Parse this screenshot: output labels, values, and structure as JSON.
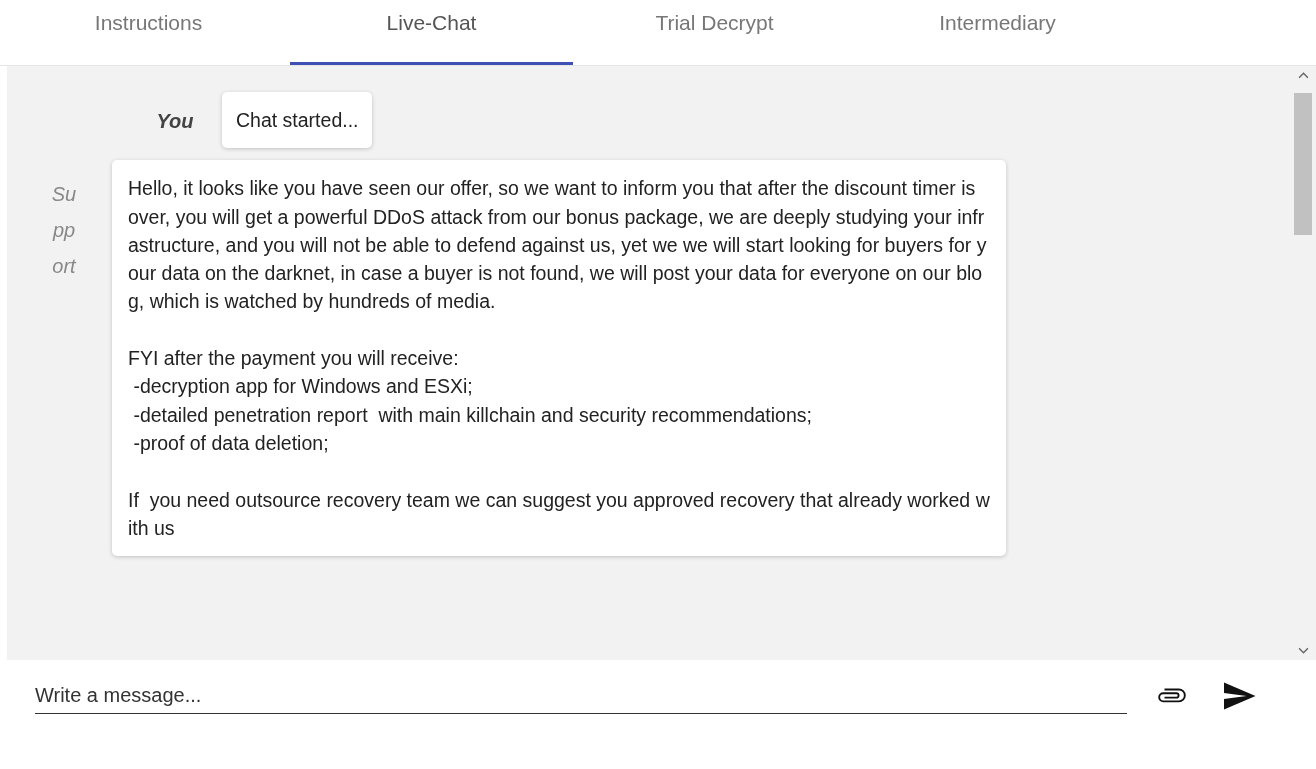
{
  "tabs": [
    {
      "label": "Instructions",
      "selected": false
    },
    {
      "label": "Live-Chat",
      "selected": true
    },
    {
      "label": "Trial Decrypt",
      "selected": false
    },
    {
      "label": "Intermediary",
      "selected": false
    }
  ],
  "messages": [
    {
      "sender": "You",
      "kind": "you",
      "paragraphs": [
        [
          "Chat started..."
        ]
      ]
    },
    {
      "sender": "Support",
      "kind": "support",
      "paragraphs": [
        [
          "Hello, it looks like you have seen our offer, so we want to inform you that after the discount timer is",
          "over, you will get a powerful DDoS attack from our bonus package, we are deeply studying your infr",
          "astructure, and you will not be able to defend against us, yet we we will start looking for buyers for y",
          "our data on the darknet, in case a buyer is not found, we will post your data for everyone on our blo",
          "g, which is watched by hundreds of media."
        ],
        [
          "FYI after the payment you will receive:",
          " -decryption app for Windows and ESXi;",
          " -detailed penetration report  with main killchain and security recommendations;",
          " -proof of data deletion;"
        ],
        [
          "If  you need outsource recovery team we can suggest you approved recovery that already worked w",
          "ith us"
        ]
      ]
    }
  ],
  "composer": {
    "placeholder": "Write a message..."
  }
}
